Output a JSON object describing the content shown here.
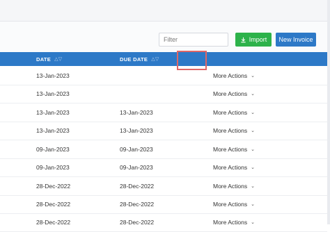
{
  "toolbar": {
    "filter_placeholder": "Filter",
    "import_label": "Import",
    "new_invoice_label": "New Invoice"
  },
  "table": {
    "columns": [
      {
        "label": "DATE",
        "sort_icon": "sort-arrows-icon"
      },
      {
        "label": "DUE DATE",
        "sort_icon": "sort-arrows-icon"
      }
    ],
    "rows": [
      {
        "date": "13-Jan-2023",
        "due_date": "",
        "action": "More Actions"
      },
      {
        "date": "13-Jan-2023",
        "due_date": "",
        "action": "More Actions"
      },
      {
        "date": "13-Jan-2023",
        "due_date": "13-Jan-2023",
        "action": "More Actions"
      },
      {
        "date": "13-Jan-2023",
        "due_date": "13-Jan-2023",
        "action": "More Actions"
      },
      {
        "date": "09-Jan-2023",
        "due_date": "09-Jan-2023",
        "action": "More Actions"
      },
      {
        "date": "09-Jan-2023",
        "due_date": "09-Jan-2023",
        "action": "More Actions"
      },
      {
        "date": "28-Dec-2022",
        "due_date": "28-Dec-2022",
        "action": "More Actions"
      },
      {
        "date": "28-Dec-2022",
        "due_date": "28-Dec-2022",
        "action": "More Actions"
      },
      {
        "date": "28-Dec-2022",
        "due_date": "28-Dec-2022",
        "action": "More Actions"
      }
    ]
  },
  "colors": {
    "header_blue": "#2d79c7",
    "import_green": "#2db24a",
    "highlight_red": "#e06666"
  }
}
